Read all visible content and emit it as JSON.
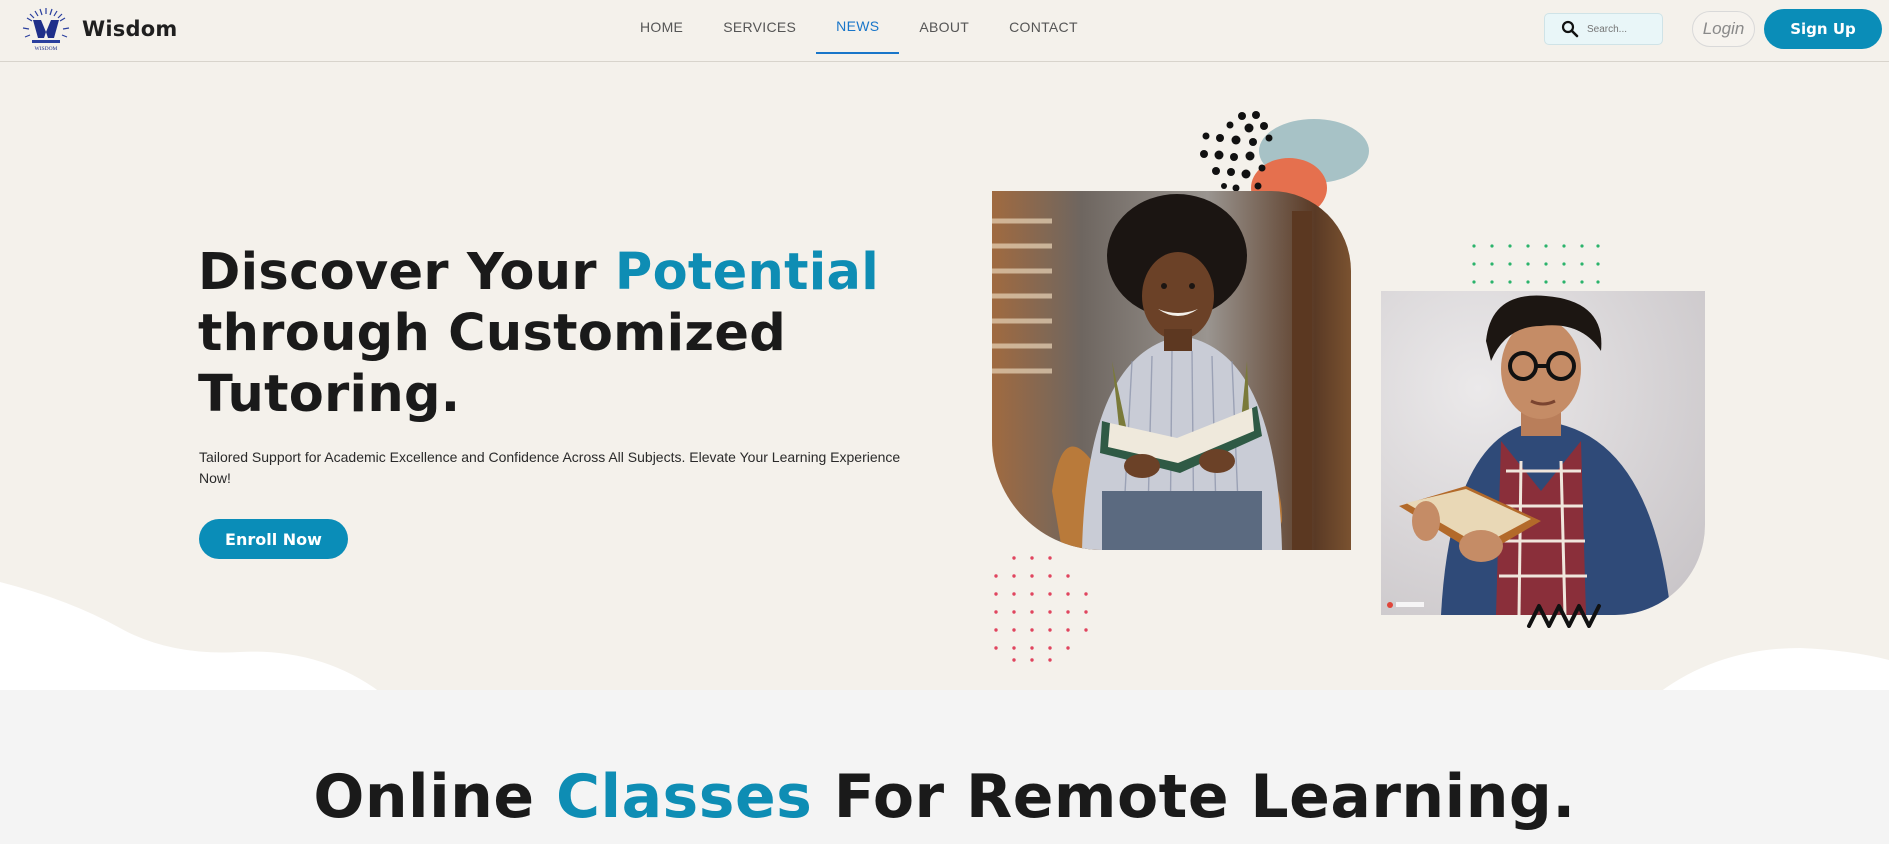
{
  "header": {
    "brand": "Wisdom",
    "logo_text": "WISDOM",
    "nav": [
      {
        "label": "HOME",
        "active": false
      },
      {
        "label": "SERVICES",
        "active": false
      },
      {
        "label": "NEWS",
        "active": true
      },
      {
        "label": "ABOUT",
        "active": false
      },
      {
        "label": "CONTACT",
        "active": false
      }
    ],
    "search_placeholder": "Search...",
    "search_icon": "search-icon",
    "login_label": "Login",
    "signup_label": "Sign Up"
  },
  "hero": {
    "title_part1": "Discover Your ",
    "title_accent": "Potential",
    "title_part2": "through Customized",
    "title_part3": "Tutoring.",
    "subtitle": "Tailored Support for Academic Excellence and Confidence Across All Subjects. Elevate Your Learning Experience Now!",
    "cta_label": "Enroll Now"
  },
  "section": {
    "title_part1": "Online ",
    "title_accent": "Classes",
    "title_part2": " For Remote Learning."
  },
  "colors": {
    "accent": "#0e8db4",
    "button": "#0a8db8",
    "background": "#f4f1eb",
    "active_nav": "#1976c9"
  }
}
